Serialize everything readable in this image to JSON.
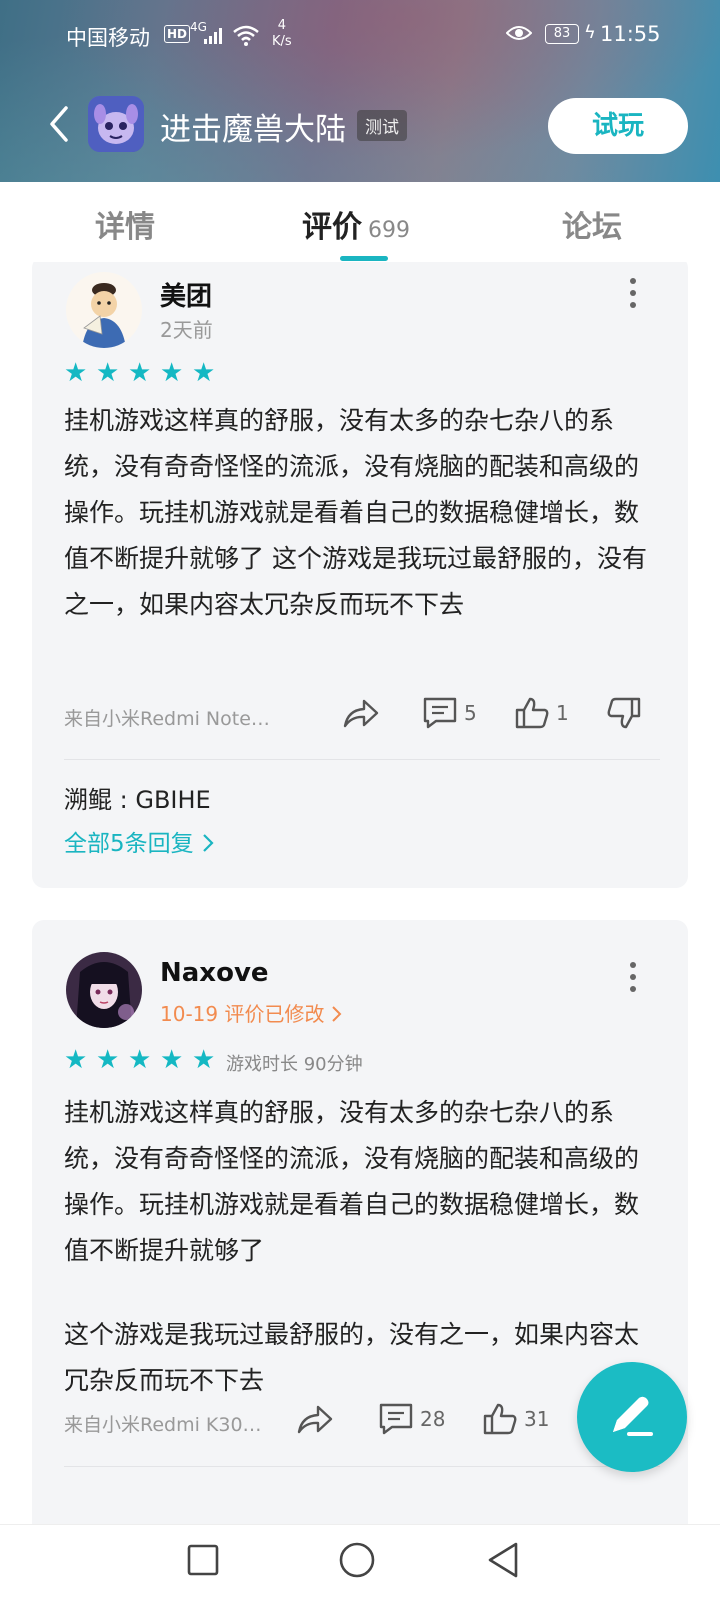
{
  "status_bar": {
    "carrier": "中国移动",
    "hd": "HD",
    "network": "4G",
    "speed_value": "4",
    "speed_unit": "K/s",
    "battery": "83",
    "time": "11:55"
  },
  "app_header": {
    "title": "进击魔兽大陆",
    "badge": "测试",
    "try_button": "试玩"
  },
  "tabs": [
    {
      "label": "详情"
    },
    {
      "label": "评价",
      "count": "699"
    },
    {
      "label": "论坛"
    }
  ],
  "reviews": [
    {
      "username": "美团",
      "time": "2天前",
      "rating": 5,
      "content": "挂机游戏这样真的舒服，没有太多的杂七杂八的系统，没有奇奇怪怪的流派，没有烧脑的配装和高级的操作。玩挂机游戏就是看着自己的数据稳健增长，数值不断提升就够了 这个游戏是我玩过最舒服的，没有之一，如果内容太冗杂反而玩不下去",
      "device": "来自小米Redmi Note…",
      "comments": "5",
      "likes": "1",
      "reply": "溯鲲 : GBIHE",
      "all_replies": "全部5条回复"
    },
    {
      "username": "Naxove",
      "time": "10-19 评价已修改",
      "rating": 5,
      "playtime": "游戏时长 90分钟",
      "content_p1": "挂机游戏这样真的舒服，没有太多的杂七杂八的系统，没有奇奇怪怪的流派，没有烧脑的配装和高级的操作。玩挂机游戏就是看着自己的数据稳健增长，数值不断提升就够了",
      "content_p2": "这个游戏是我玩过最舒服的，没有之一，如果内容太冗杂反而玩不下去",
      "device": "来自小米Redmi K30…",
      "comments": "28",
      "likes": "31"
    }
  ],
  "colors": {
    "accent": "#1ab5c1",
    "edited": "#f28b4f",
    "card_bg": "#f4f5f7"
  }
}
